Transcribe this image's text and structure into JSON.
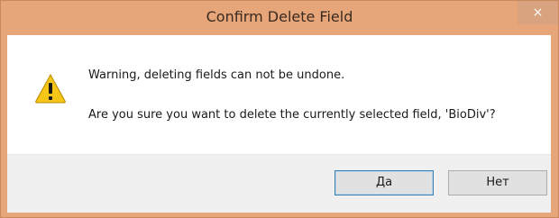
{
  "window": {
    "title": "Confirm Delete Field",
    "close_glyph": "×"
  },
  "message": {
    "line1": "Warning, deleting fields can not be undone.",
    "line2": "Are you sure you want to delete the currently selected field, 'BioDiv'?",
    "icon": "warning-icon"
  },
  "buttons": {
    "yes_label": "Да",
    "no_label": "Нет"
  },
  "colors": {
    "titlebar": "#e6a679",
    "accent_focus": "#3c7fb1",
    "warning_yellow": "#f5c518"
  }
}
